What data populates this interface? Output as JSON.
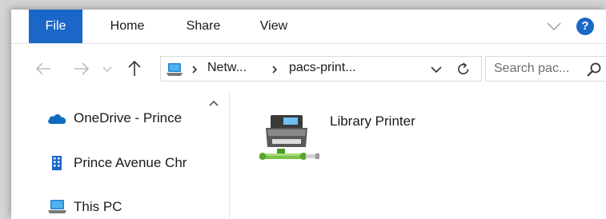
{
  "ribbon": {
    "tabs": [
      "File",
      "Home",
      "Share",
      "View"
    ],
    "help_label": "?",
    "accent_color": "#1a67c7"
  },
  "address_bar": {
    "location_icon": "this-pc-icon",
    "breadcrumbs": [
      "Netw...",
      "pacs-print..."
    ],
    "nav_icons": [
      "back-arrow-icon",
      "forward-arrow-icon",
      "recent-locations-icon",
      "up-arrow-icon",
      "refresh-icon"
    ]
  },
  "search": {
    "placeholder": "Search pac..."
  },
  "navigation_pane": {
    "items": [
      {
        "label": "OneDrive - Prince",
        "icon": "onedrive-cloud-icon"
      },
      {
        "label": "Prince Avenue Chr",
        "icon": "building-icon"
      },
      {
        "label": "This PC",
        "icon": "this-pc-icon"
      }
    ]
  },
  "content": {
    "items": [
      {
        "label": "Library Printer",
        "icon": "network-printer-icon"
      }
    ]
  }
}
